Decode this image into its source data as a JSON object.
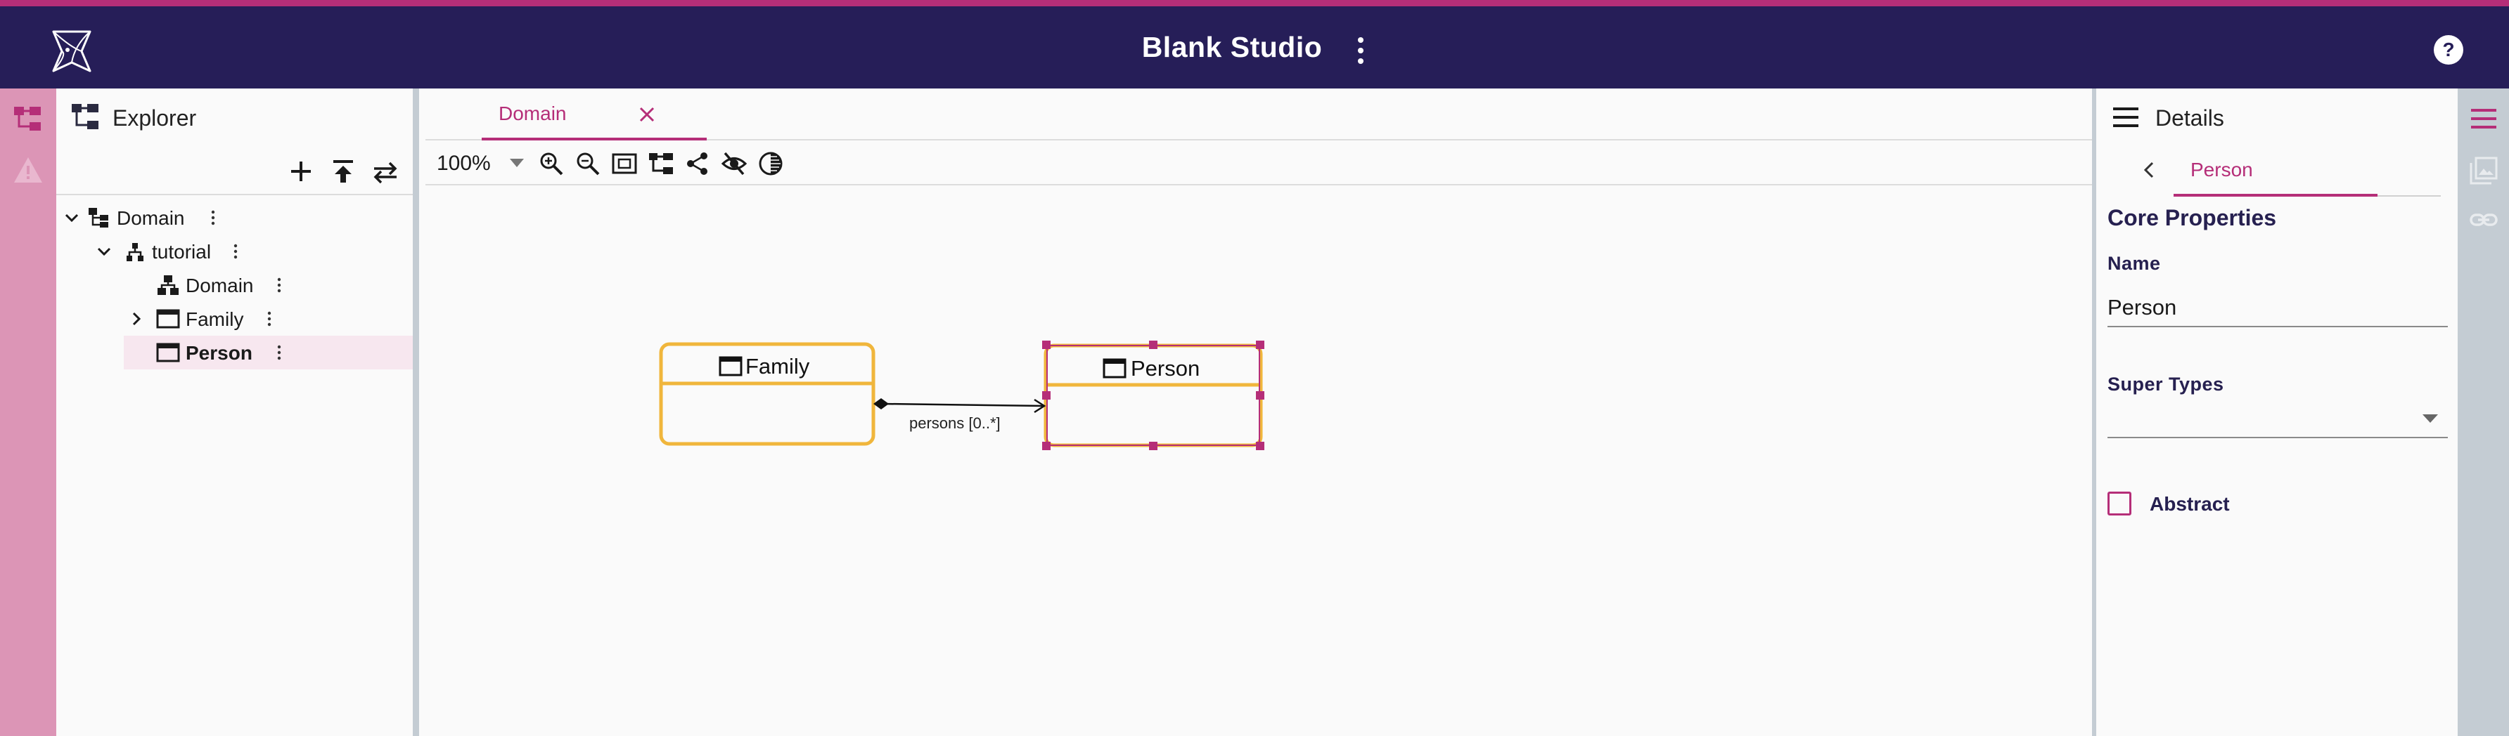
{
  "app": {
    "title": "Blank Studio",
    "accent": "#b52e78",
    "header_bg": "#261e58"
  },
  "left_rail": {
    "icons": [
      "explorer-icon",
      "warning-icon"
    ]
  },
  "explorer": {
    "title": "Explorer",
    "toolbar": [
      "add-icon",
      "upload-icon",
      "swap-icon"
    ],
    "tree": [
      {
        "label": "Domain",
        "icon": "domain-tree-icon",
        "expanded": true
      },
      {
        "label": "tutorial",
        "icon": "package-icon",
        "expanded": true
      },
      {
        "label": "Domain",
        "icon": "diagram-icon"
      },
      {
        "label": "Family",
        "icon": "class-icon",
        "expandable": true
      },
      {
        "label": "Person",
        "icon": "class-icon",
        "selected": true
      }
    ]
  },
  "editor": {
    "tab": {
      "label": "Domain"
    },
    "toolbar": {
      "zoom": "100%"
    },
    "diagram": {
      "nodes": [
        {
          "label": "Family",
          "selected": false
        },
        {
          "label": "Person",
          "selected": true
        }
      ],
      "edge": {
        "label": "persons [0..*]",
        "from": "Family",
        "to": "Person"
      },
      "node_border": "#f0b63c",
      "selection_color": "#b52e78"
    }
  },
  "details": {
    "title": "Details",
    "breadcrumb": "Person",
    "section": "Core Properties",
    "name_label": "Name",
    "name_value": "Person",
    "supertypes_label": "Super Types",
    "supertypes_value": "",
    "abstract_label": "Abstract",
    "abstract_checked": false
  },
  "right_rail": {
    "icons": [
      "details-menu-icon",
      "image-gallery-icon",
      "link-icon"
    ]
  }
}
